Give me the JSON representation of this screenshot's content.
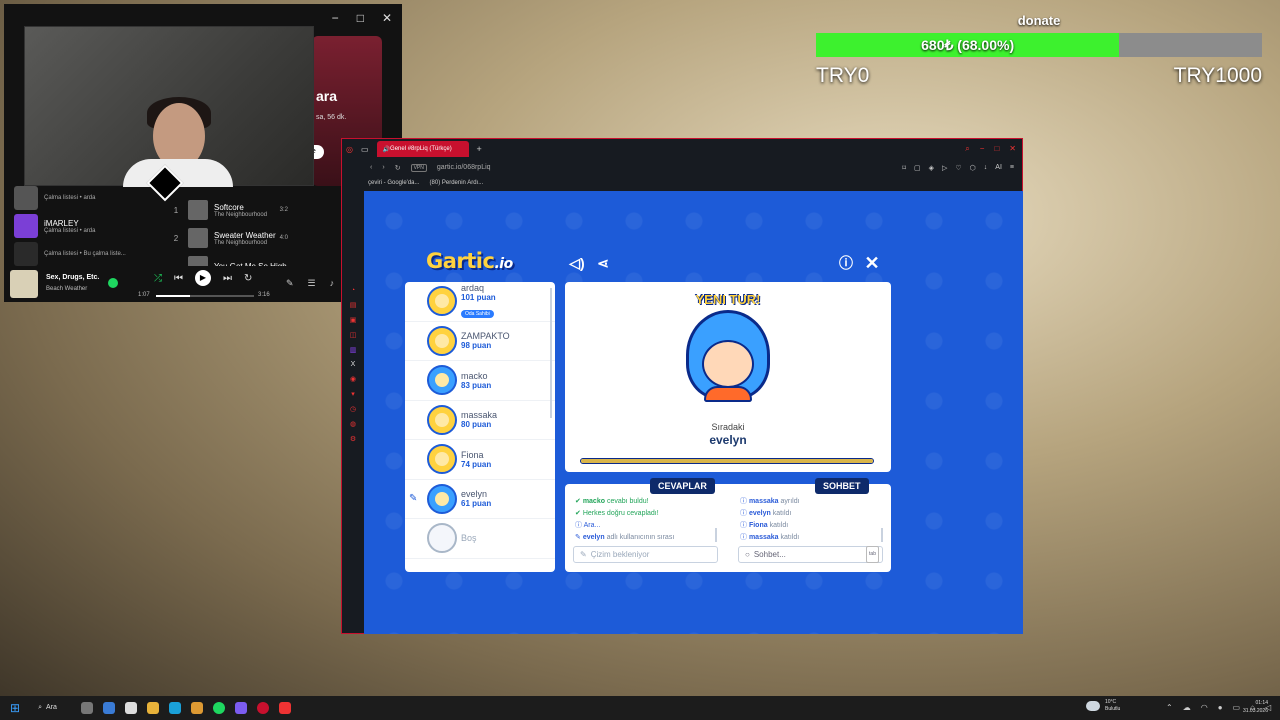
{
  "donate": {
    "title": "donate",
    "progress_text": "680₺ (68.00%)",
    "progress_fraction": 0.68,
    "min_label": "TRY0",
    "max_label": "TRY1000"
  },
  "spotify": {
    "hero_title": "ara",
    "hero_sub": "sa, 56 dk.",
    "hero_btn": "le",
    "library": [
      {
        "title": "",
        "sub": "Çalma listesi • arda"
      },
      {
        "title": "iMARLEY",
        "sub": "Çalma listesi • arda"
      },
      {
        "title": "",
        "sub": "Çalma listesi • Bu çalma liste..."
      }
    ],
    "tracks": [
      {
        "num": "1",
        "title": "Softcore",
        "artist": "The Neighbourhood",
        "duration": "3:2"
      },
      {
        "num": "2",
        "title": "Sweater Weather",
        "artist": "The Neighbourhood",
        "duration": "4:0"
      },
      {
        "num": "",
        "title": "You Get Me So High",
        "artist": "",
        "duration": ""
      }
    ],
    "now_playing": {
      "title": "Sex, Drugs, Etc.",
      "artist": "Beach Weather",
      "elapsed": "1:07",
      "total": "3:16",
      "progress_fraction": 0.35
    }
  },
  "browser": {
    "tab_title": "Genel #8rpLiq (Türkçe)",
    "url": "gartic.io/068rpLiq",
    "vpn": "VPN",
    "bookmarks": [
      "çeviri - Google'da...",
      "(80) Perdenin Ardı..."
    ],
    "ai_label": "AI"
  },
  "gartic": {
    "logo_main": "Gartic",
    "logo_io": ".io",
    "players": [
      {
        "name": "ardaq",
        "score": "101 puan",
        "badge": "Oda Sahibi",
        "color": "#ffd23f"
      },
      {
        "name": "ZAMPAKTO",
        "score": "98 puan",
        "color": "#ffd23f"
      },
      {
        "name": "macko",
        "score": "83 puan",
        "color": "#3aa0ff"
      },
      {
        "name": "massaka",
        "score": "80 puan",
        "color": "#ffd23f"
      },
      {
        "name": "Fiona",
        "score": "74 puan",
        "color": "#ffd23f"
      },
      {
        "name": "evelyn",
        "score": "61 puan",
        "color": "#3aa0ff",
        "drawing": true
      }
    ],
    "empty_slot": "Boş",
    "board": {
      "new_round": "YENI TUR!",
      "next_label": "Sıradaki",
      "next_name": "evelyn",
      "timer_fraction": 1.0
    },
    "answers": {
      "header": "CEVAPLAR",
      "messages": [
        {
          "who": "macko",
          "text": "cevabı buldu!"
        },
        {
          "who": "",
          "text": "Herkes doğru cevapladı!"
        },
        {
          "who": "",
          "text": "Ara..."
        },
        {
          "who": "evelyn",
          "text": "adlı kullanıcının sırası"
        }
      ],
      "input_placeholder": "Çizim bekleniyor"
    },
    "chat": {
      "header": "SOHBET",
      "messages": [
        {
          "who": "massaka",
          "text": "ayrıldı"
        },
        {
          "who": "evelyn",
          "text": "katıldı"
        },
        {
          "who": "Fiona",
          "text": "katıldı"
        },
        {
          "who": "massaka",
          "text": "katıldı"
        }
      ],
      "input_placeholder": "Sohbet...",
      "tab_hint": "tab"
    }
  },
  "taskbar": {
    "search_label": "Ara",
    "weather_temp": "10°C",
    "weather_desc": "Bulutlu",
    "time": "01:14",
    "date": "31.03.2026"
  }
}
